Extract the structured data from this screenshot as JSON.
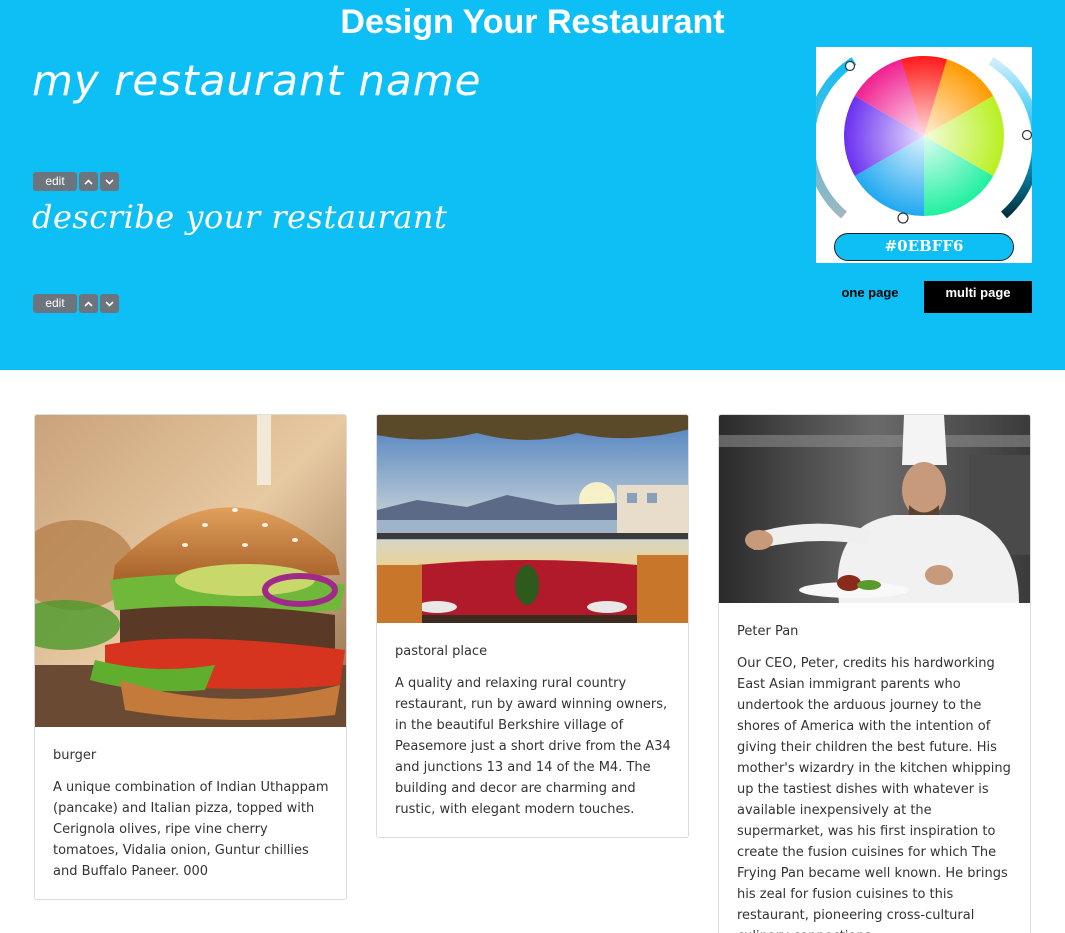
{
  "header": {
    "page_title": "Design Your Restaurant",
    "restaurant_name": "my restaurant name",
    "restaurant_description": "describe your restaurant",
    "name_controls": {
      "edit_label": "edit",
      "up_icon": "chevron-up-icon",
      "down_icon": "chevron-down-icon"
    },
    "desc_controls": {
      "edit_label": "edit",
      "up_icon": "chevron-up-icon",
      "down_icon": "chevron-down-icon"
    }
  },
  "color_picker": {
    "hex_value": "#0EBFF6"
  },
  "layout_mode": {
    "one_page_label": "one page",
    "multi_page_label": "multi page",
    "selected": "multi page"
  },
  "colors": {
    "accent": "#0ebff6",
    "button_gray": "#6c757d",
    "active_black": "#000000"
  },
  "cards": [
    {
      "title": "burger",
      "text": "A unique combination of Indian Uthappam (pancake) and Italian pizza, topped with Cerignola olives, ripe vine cherry tomatoes, Vidalia onion, Guntur chillies and Buffalo Paneer. 000"
    },
    {
      "title": "pastoral place",
      "text": "A quality and relaxing rural country restaurant, run by award winning owners, in the beautiful Berkshire village of Peasemore just a short drive from the A34 and junctions 13 and 14 of the M4. The building and decor are charming and rustic, with elegant modern touches."
    },
    {
      "title": "Peter Pan",
      "text": "Our CEO, Peter, credits his hardworking East Asian immigrant parents who undertook the arduous journey to the shores of America with the intention of giving their children the best future. His mother's wizardry in the kitchen whipping up the tastiest dishes with whatever is available inexpensively at the supermarket, was his first inspiration to create the fusion cuisines for which The Frying Pan became well known. He brings his zeal for fusion cuisines to this restaurant, pioneering cross-cultural culinary connections.."
    }
  ]
}
